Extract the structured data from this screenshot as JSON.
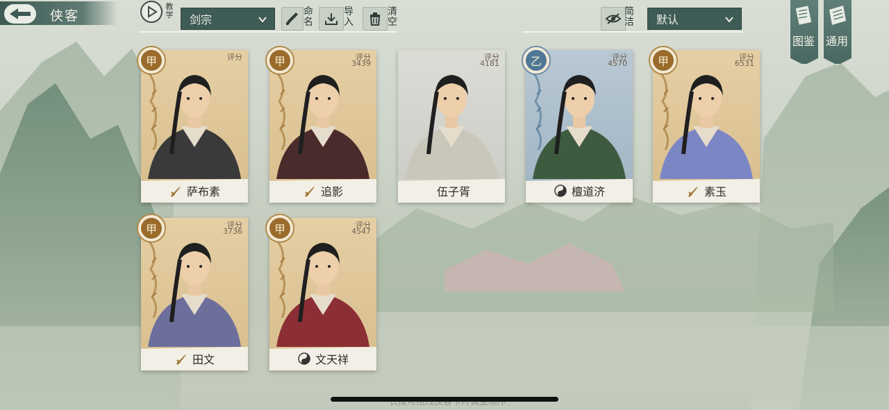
{
  "header": {
    "title": "侠客",
    "tutorial_label": "教学",
    "sect_select": "剑宗",
    "rename_label": "命名",
    "import_label": "导入",
    "clear_label": "清空",
    "simple_label": "简洁",
    "sort_select": "默认"
  },
  "side_tabs": {
    "codex_label": "图鉴",
    "general_label": "通用"
  },
  "cards": [
    {
      "name": "萨布素",
      "grade": "甲",
      "score_label": "评分",
      "score": "",
      "grade_color": "#9a6b2b",
      "faction_icon": "sword-icon"
    },
    {
      "name": "追影",
      "grade": "甲",
      "score_label": "评分",
      "score": "3439",
      "grade_color": "#9a6b2b",
      "faction_icon": "sword-icon"
    },
    {
      "name": "伍子胥",
      "grade": "",
      "score_label": "评分",
      "score": "4181",
      "grade_color": "",
      "faction_icon": ""
    },
    {
      "name": "檀道济",
      "grade": "乙",
      "score_label": "评分",
      "score": "4570",
      "grade_color": "#4f7896",
      "faction_icon": "yinyang-icon"
    },
    {
      "name": "素玉",
      "grade": "甲",
      "score_label": "评分",
      "score": "6531",
      "grade_color": "#9a6b2b",
      "faction_icon": "sword-icon"
    },
    {
      "name": "田文",
      "grade": "甲",
      "score_label": "评分",
      "score": "3736",
      "grade_color": "#9a6b2b",
      "faction_icon": "sword-icon"
    },
    {
      "name": "文天祥",
      "grade": "甲",
      "score_label": "评分",
      "score": "4547",
      "grade_color": "#9a6b2b",
      "faction_icon": "yinyang-icon"
    }
  ],
  "footer": {
    "hint": "长按可拖拽侠客卡片调整顺序"
  }
}
